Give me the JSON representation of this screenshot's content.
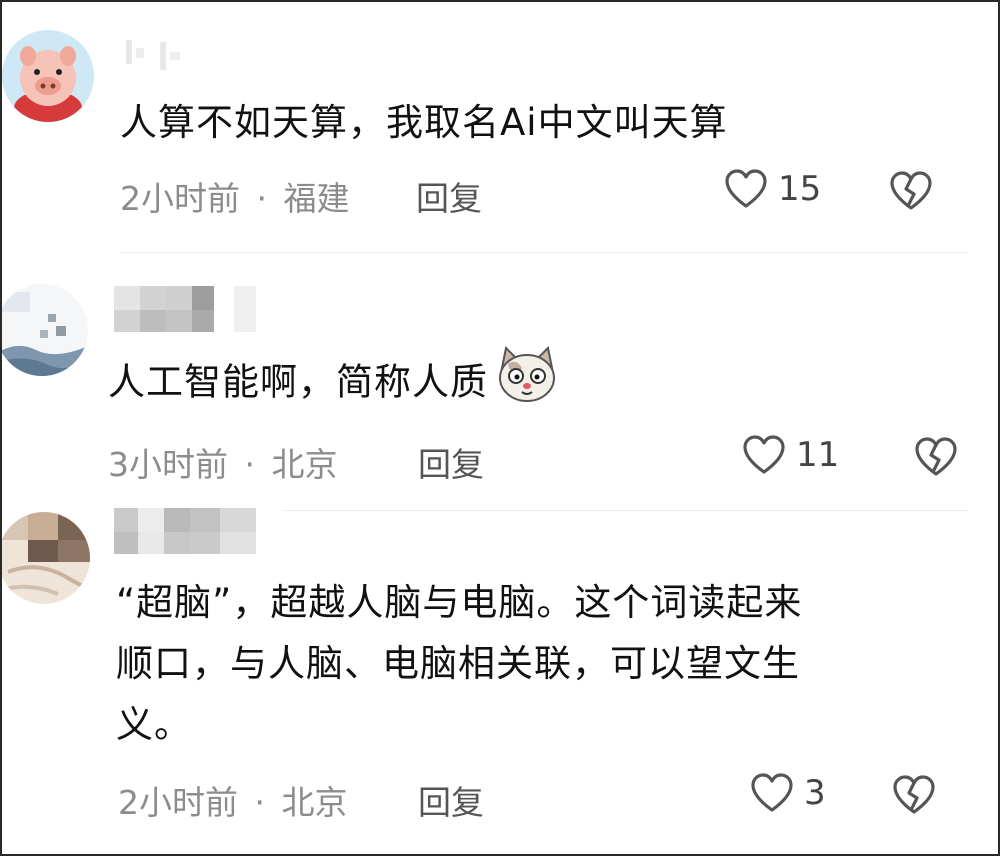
{
  "comments": [
    {
      "text": "人算不如天算，我取名Ai中文叫天算",
      "time": "2小时前",
      "sep": "·",
      "location": "福建",
      "reply": "回复",
      "likes": "15"
    },
    {
      "text": "人工智能啊，简称人质",
      "time": "3小时前",
      "sep": "·",
      "location": "北京",
      "reply": "回复",
      "likes": "11",
      "emoji": "cat-face-emoji"
    },
    {
      "text_lines": [
        "“超脑”，超越人脑与电脑。这个词读起来",
        "顺口，与人脑、电脑相关联，可以望文生",
        "义。"
      ],
      "time": "2小时前",
      "sep": "·",
      "location": "北京",
      "reply": "回复",
      "likes": "3"
    }
  ],
  "colors": {
    "meta": "#8c8c8c",
    "text": "#111111",
    "icon": "#555555",
    "border": "#2a2a2a"
  }
}
